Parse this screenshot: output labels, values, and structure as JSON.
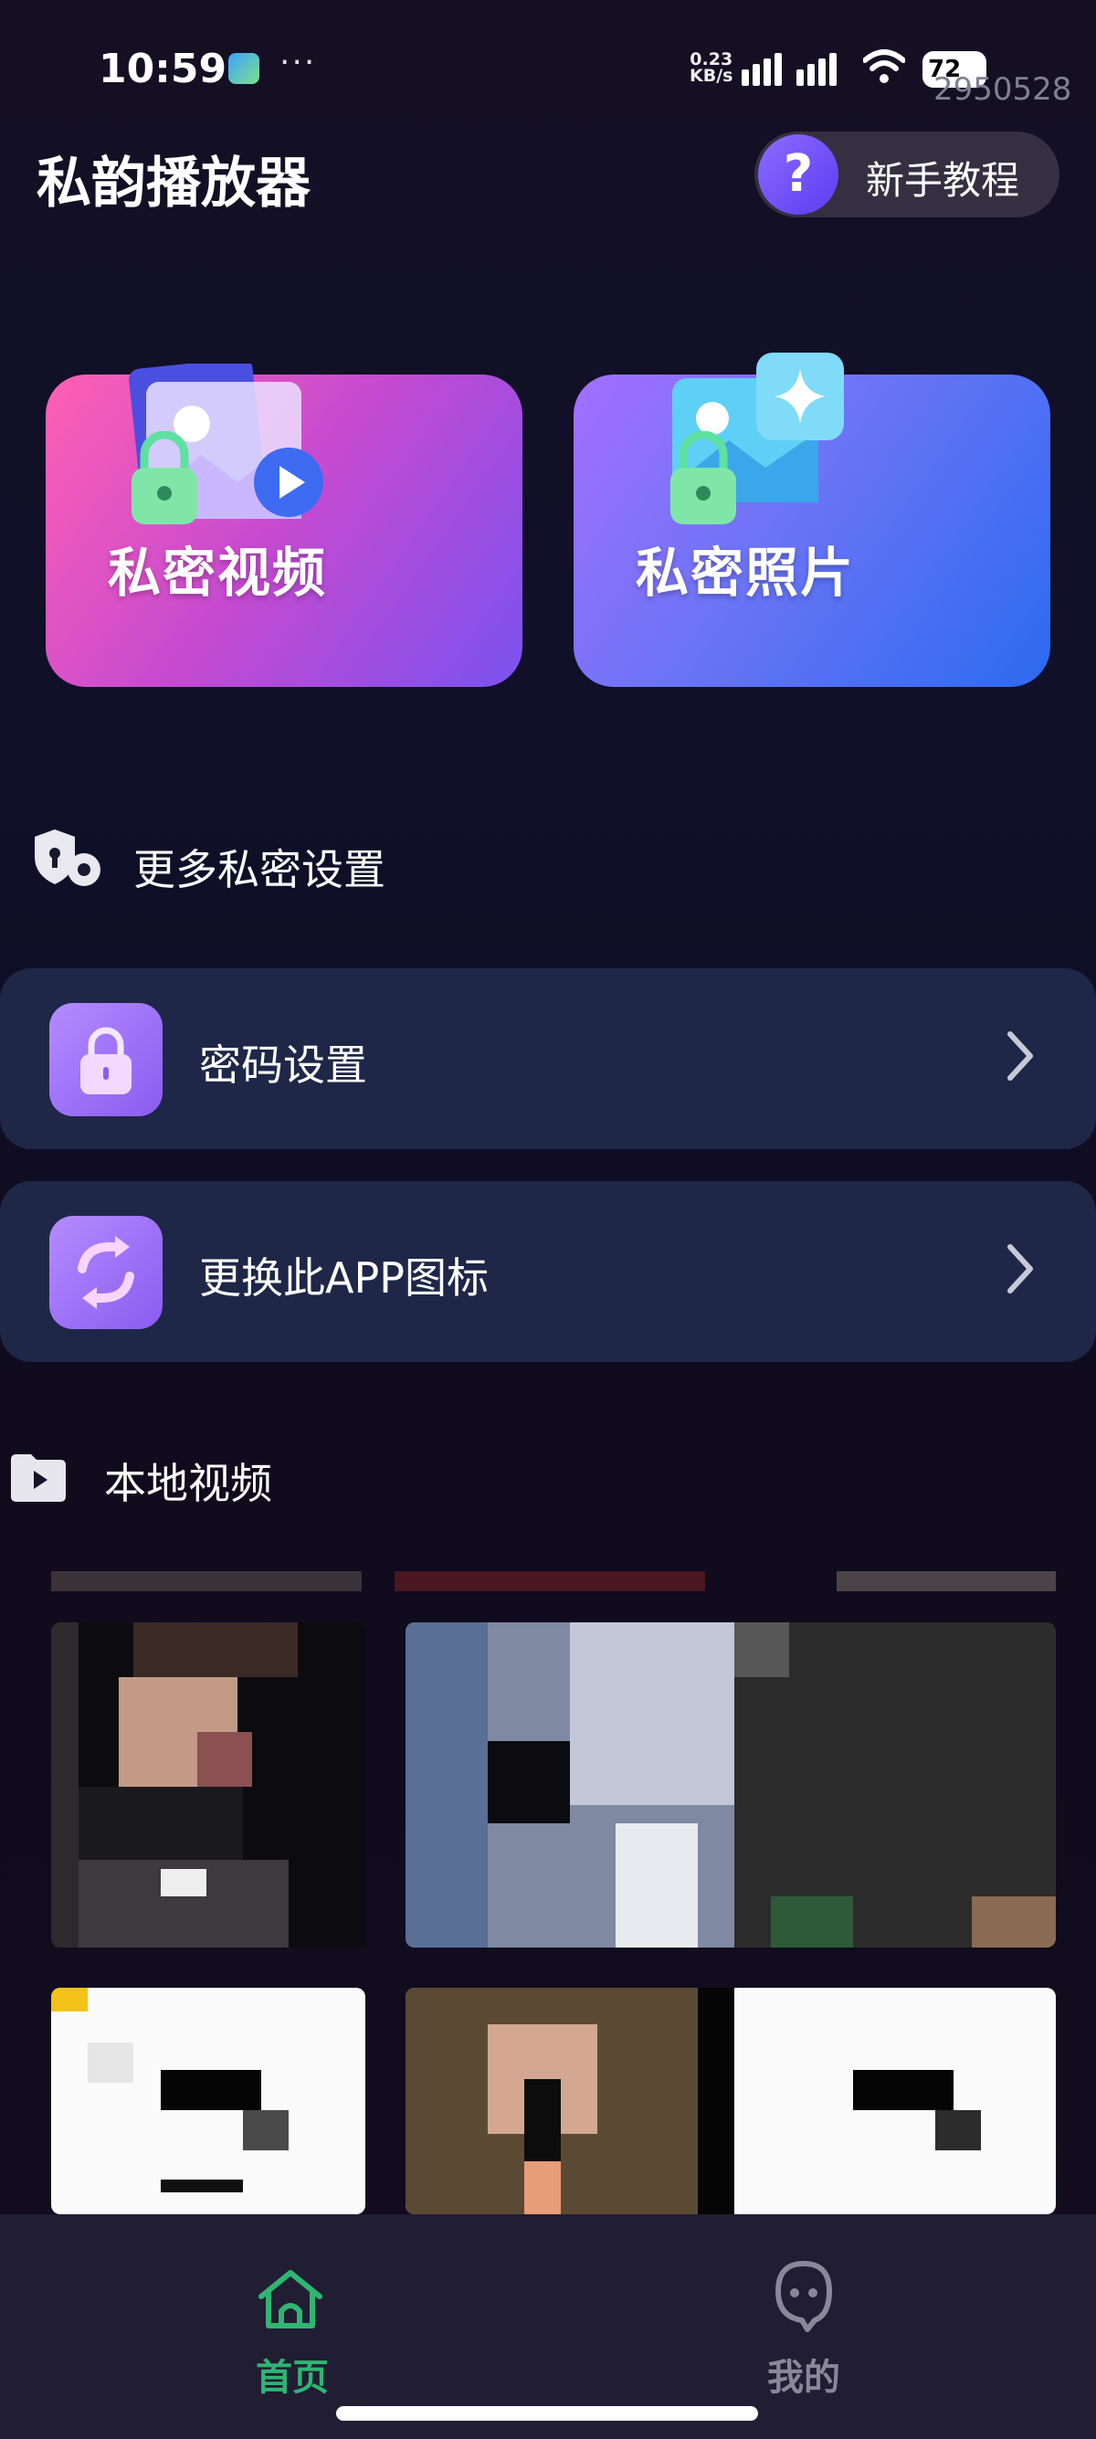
{
  "status_bar": {
    "time": "10:59",
    "net_speed_value": "0.23",
    "net_speed_unit": "KB/s",
    "battery": "72",
    "watermark": "2950528"
  },
  "header": {
    "title": "私韵播放器",
    "tutorial_label": "新手教程"
  },
  "cards": {
    "video_label": "私密视频",
    "photo_label": "私密照片"
  },
  "settings_section": {
    "title": "更多私密设置",
    "items": [
      {
        "label": "密码设置",
        "icon": "lock-icon"
      },
      {
        "label": "更换此APP图标",
        "icon": "swap-icon"
      }
    ]
  },
  "local_videos": {
    "title": "本地视频"
  },
  "bottom_nav": {
    "items": [
      {
        "label": "首页",
        "icon": "home-icon",
        "active": true
      },
      {
        "label": "我的",
        "icon": "profile-icon",
        "active": false
      }
    ]
  },
  "colors": {
    "active_tab": "#2fb572",
    "inactive_tab": "#8a8898",
    "row_background": "#1e2747",
    "accent_purple": "#8a5cf0"
  }
}
